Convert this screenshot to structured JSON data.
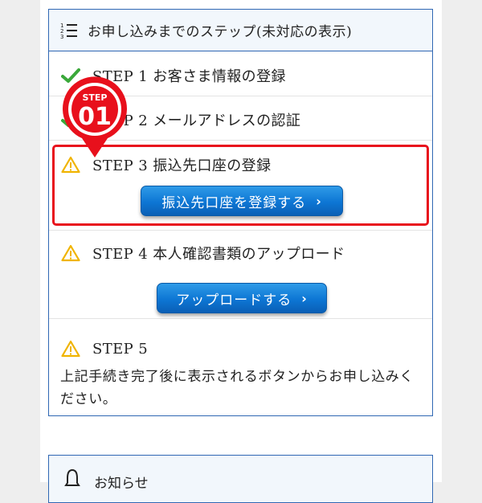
{
  "colors": {
    "accent_border": "#2f67b3",
    "highlight": "#e8101c",
    "button": "#0d76d4",
    "check": "#3aa83a",
    "warning": "#f0b400"
  },
  "header": {
    "icon": "numbered-list-icon",
    "title": "お申し込みまでのステップ(未対応の表示)"
  },
  "steps": [
    {
      "label": "STEP 1  お客さま情報の登録",
      "status": "done",
      "icon": "check-icon"
    },
    {
      "label": "STEP 2  メールアドレスの認証",
      "status": "done",
      "icon": "check-icon"
    },
    {
      "label": "STEP 3  振込先口座の登録",
      "status": "pending",
      "icon": "warning-icon",
      "button": "振込先口座を登録する"
    },
    {
      "label": "STEP 4  本人確認書類のアップロード",
      "status": "pending",
      "icon": "warning-icon",
      "button": "アップロードする"
    },
    {
      "label": "STEP 5",
      "status": "pending",
      "icon": "warning-icon",
      "note": "上記手続き完了後に表示されるボタンからお申し込みください。"
    }
  ],
  "badge": {
    "top": "STEP",
    "number": "01"
  },
  "next_section": {
    "icon": "bell-icon",
    "title": "お知らせ"
  }
}
